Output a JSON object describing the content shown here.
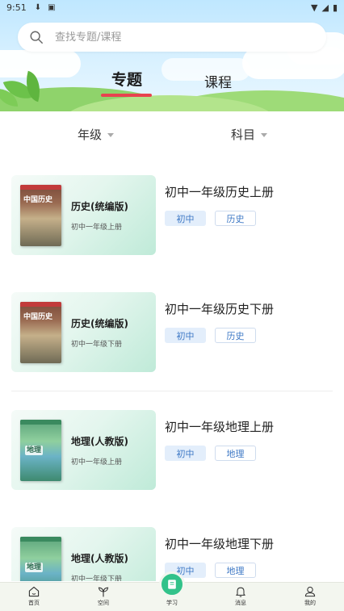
{
  "status_bar": {
    "time": "9:51"
  },
  "search": {
    "placeholder": "查找专题/课程"
  },
  "tabs": [
    {
      "label": "专题",
      "active": true
    },
    {
      "label": "课程",
      "active": false
    }
  ],
  "filters": [
    {
      "label": "年级"
    },
    {
      "label": "科目"
    }
  ],
  "items": [
    {
      "title": "初中一年级历史上册",
      "card_title": "历史(统编版)",
      "card_subtitle": "初中一年级上册",
      "cover_text": "中国历史",
      "tags": [
        "初中",
        "历史"
      ],
      "subject": "history"
    },
    {
      "title": "初中一年级历史下册",
      "card_title": "历史(统编版)",
      "card_subtitle": "初中一年级下册",
      "cover_text": "中国历史",
      "tags": [
        "初中",
        "历史"
      ],
      "subject": "history"
    },
    {
      "title": "初中一年级地理上册",
      "card_title": "地理(人教版)",
      "card_subtitle": "初中一年级上册",
      "cover_text": "地理",
      "tags": [
        "初中",
        "地理"
      ],
      "subject": "geography"
    },
    {
      "title": "初中一年级地理下册",
      "card_title": "地理(人教版)",
      "card_subtitle": "初中一年级下册",
      "cover_text": "地理",
      "tags": [
        "初中",
        "地理"
      ],
      "subject": "geography"
    }
  ],
  "bottom_nav": [
    {
      "label": "首页",
      "icon": "home-icon"
    },
    {
      "label": "空间",
      "icon": "sprout-icon"
    },
    {
      "label": "学习",
      "icon": "book-icon",
      "active": true
    },
    {
      "label": "消息",
      "icon": "bell-icon"
    },
    {
      "label": "我的",
      "icon": "user-icon"
    }
  ],
  "colors": {
    "accent": "#e8434f",
    "tag_text": "#3d78c5",
    "nav_active": "#32c28a"
  }
}
